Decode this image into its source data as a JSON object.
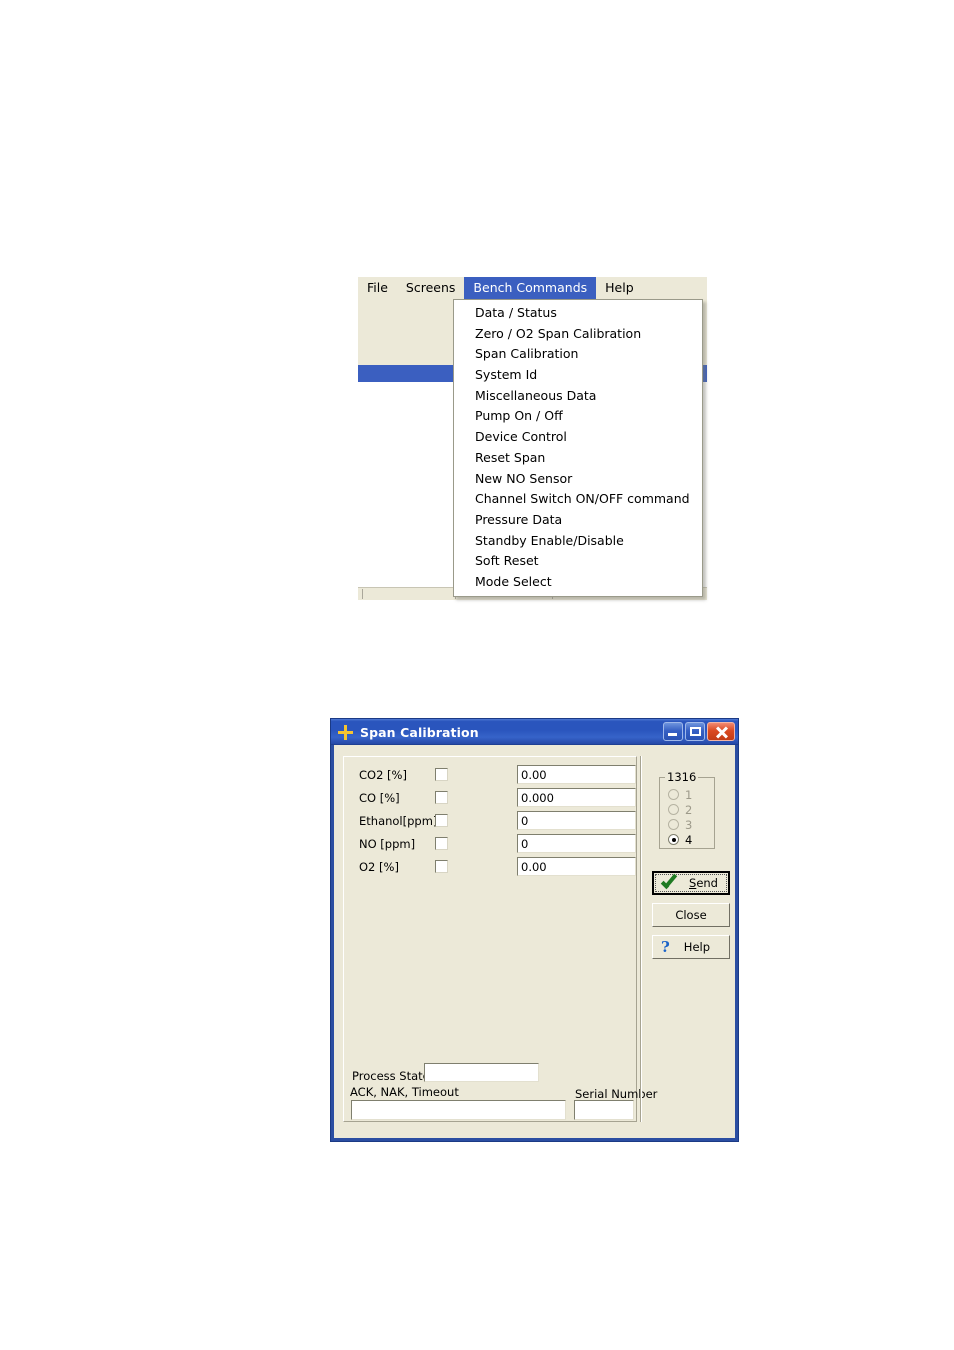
{
  "app_window": {
    "menubar": [
      {
        "label": "File",
        "active": false
      },
      {
        "label": "Screens",
        "active": false
      },
      {
        "label": "Bench Commands",
        "active": true
      },
      {
        "label": "Help",
        "active": false
      }
    ],
    "menu_popup": {
      "items": [
        "Data / Status",
        "Zero / O2 Span Calibration",
        "Span Calibration",
        "System Id",
        "Miscellaneous Data",
        "Pump On / Off",
        "Device Control",
        "Reset Span",
        "New NO Sensor",
        "Channel Switch ON/OFF command",
        "Pressure Data",
        "Standby Enable/Disable",
        "Soft Reset",
        "Mode Select"
      ]
    }
  },
  "dialog": {
    "title": "Span Calibration",
    "icon": "cross-icon",
    "title_buttons": [
      {
        "name": "minimize-button",
        "glyph": "minimize-icon"
      },
      {
        "name": "maximize-button",
        "glyph": "maximize-icon"
      },
      {
        "name": "close-button",
        "glyph": "close-icon"
      }
    ],
    "fields": [
      {
        "label": "CO2 [%]",
        "checked": false,
        "value": "0.00"
      },
      {
        "label": "CO [%]",
        "checked": false,
        "value": "0.000"
      },
      {
        "label": "Ethanol[ppm]",
        "checked": false,
        "value": "0"
      },
      {
        "label": "NO [ppm]",
        "checked": false,
        "value": "0"
      },
      {
        "label": "O2 [%]",
        "checked": false,
        "value": "0.00"
      }
    ],
    "group": {
      "title": "1316",
      "options": [
        {
          "label": "1",
          "selected": false,
          "disabled": true
        },
        {
          "label": "2",
          "selected": false,
          "disabled": true
        },
        {
          "label": "3",
          "selected": false,
          "disabled": true
        },
        {
          "label": "4",
          "selected": true,
          "disabled": false
        }
      ]
    },
    "buttons": {
      "send": {
        "label": "Send",
        "accel": "S",
        "icon": "green-check-icon",
        "focused": true
      },
      "close": {
        "label": "Close"
      },
      "help": {
        "label": "Help",
        "icon": "question-mark-icon"
      }
    },
    "status": {
      "process_state_label": "Process State",
      "process_state_value": "",
      "ack_label": "ACK, NAK, Timeout",
      "ack_value": "",
      "serial_label": "Serial Number",
      "serial_value": ""
    }
  },
  "colors": {
    "titlebar_blue": "#2a55bd",
    "menu_highlight": "#3b5fc0",
    "dialog_face": "#ece9d8",
    "check_green": "#1f7a22",
    "help_blue": "#1c64c8",
    "icon_gold": "#f5c431",
    "close_red": "#da4a22"
  }
}
